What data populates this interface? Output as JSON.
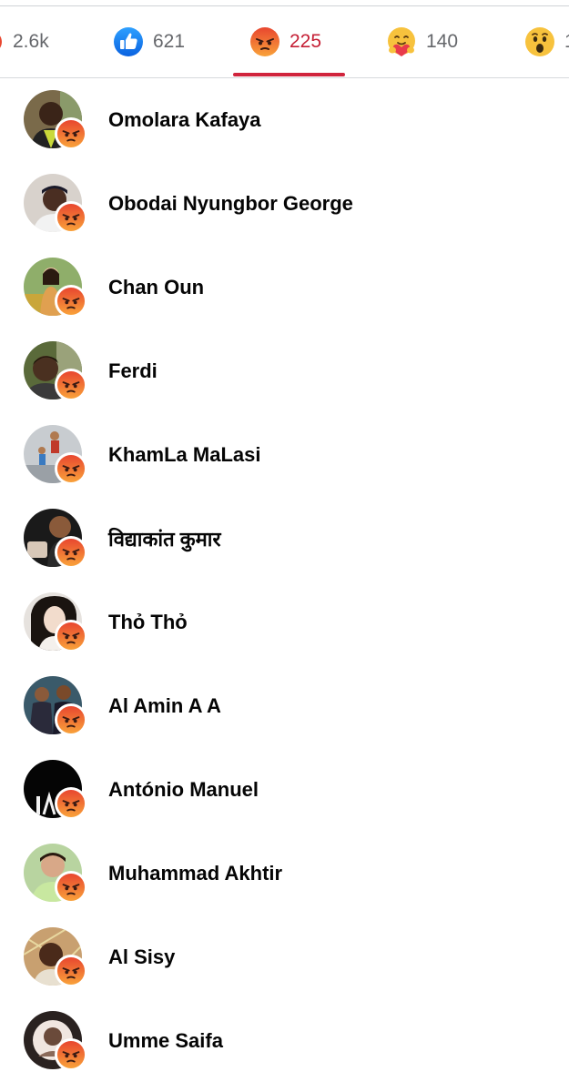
{
  "reaction_tabs": [
    {
      "count": "2.6k",
      "icon": "all-reactions-icon",
      "active": false
    },
    {
      "count": "621",
      "icon": "like-icon",
      "active": false
    },
    {
      "count": "225",
      "icon": "angry-icon",
      "active": true
    },
    {
      "count": "140",
      "icon": "care-icon",
      "active": false
    },
    {
      "count": "1",
      "icon": "wow-icon",
      "active": false
    }
  ],
  "colors": {
    "active_tab": "#c51f35",
    "inactive_tab": "#65676b",
    "like_blue": "#1877f2",
    "angry_top": "#e8462f",
    "angry_bottom": "#f9a23a"
  },
  "people": [
    {
      "name": "Omolara Kafaya",
      "reaction": "angry-icon"
    },
    {
      "name": "Obodai Nyungbor George",
      "reaction": "angry-icon"
    },
    {
      "name": "Chan Oun",
      "reaction": "angry-icon"
    },
    {
      "name": "Ferdi",
      "reaction": "angry-icon"
    },
    {
      "name": "KhamLa MaLasi",
      "reaction": "angry-icon"
    },
    {
      "name": "विद्याकांत कुमार",
      "reaction": "angry-icon"
    },
    {
      "name": "Thỏ Thỏ",
      "reaction": "angry-icon"
    },
    {
      "name": "Al Amin A A",
      "reaction": "angry-icon"
    },
    {
      "name": "António Manuel",
      "reaction": "angry-icon"
    },
    {
      "name": "Muhammad Akhtir",
      "reaction": "angry-icon"
    },
    {
      "name": "Al Sisy",
      "reaction": "angry-icon"
    },
    {
      "name": "Umme Saifa",
      "reaction": "angry-icon"
    }
  ]
}
